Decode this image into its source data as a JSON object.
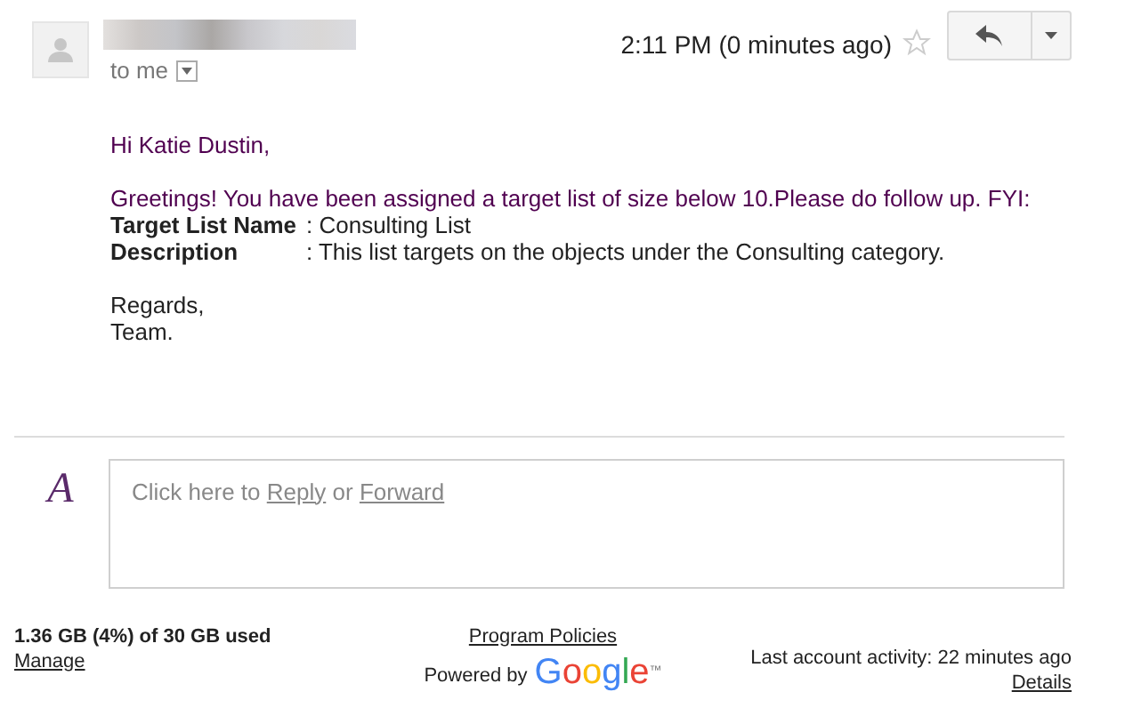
{
  "message": {
    "time": "2:11 PM (0 minutes ago)",
    "starred": false,
    "recipient": "to me"
  },
  "body": {
    "greeting": "Hi Katie Dustin,",
    "intro": "Greetings! You have been assigned a target list of size below 10.Please do follow up. FYI:",
    "fields": [
      {
        "label": "Target List Name",
        "value": ": Consulting List"
      },
      {
        "label": "Description",
        "value": ": This list targets on the objects under the Consulting category."
      }
    ],
    "closing": [
      "Regards,",
      "Team."
    ]
  },
  "reply_box": {
    "avatar_letter": "A",
    "prefix": "Click here to",
    "reply": "Reply",
    "or": "or",
    "forward": "Forward"
  },
  "footer": {
    "storage": "1.36 GB (4%) of 30 GB used",
    "manage": "Manage",
    "policies": "Program Policies",
    "powered_by": "Powered by",
    "logo": "Google",
    "logo_mark": "™",
    "activity": "Last account activity: 22 minutes ago",
    "details": "Details"
  }
}
